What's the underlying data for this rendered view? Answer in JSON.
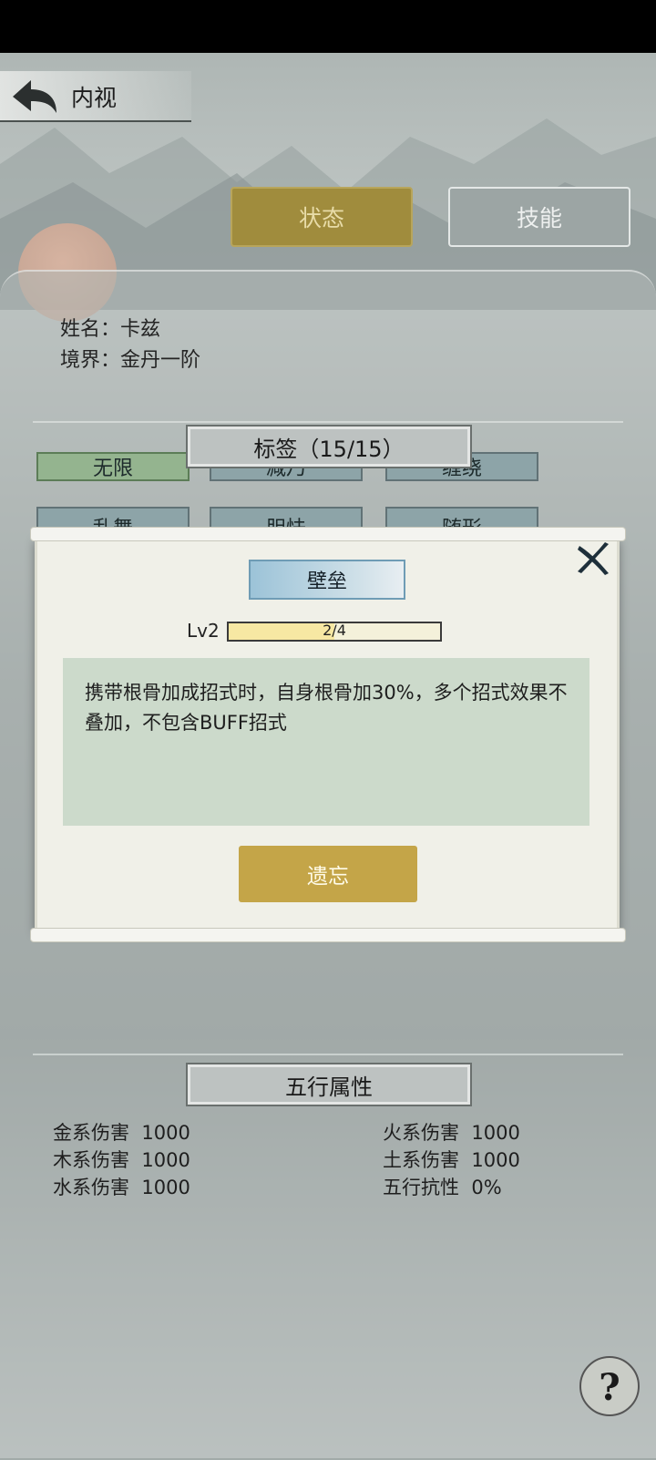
{
  "header": {
    "title": "内视"
  },
  "tabs": [
    {
      "label": "状态",
      "active": true
    },
    {
      "label": "技能",
      "active": false
    }
  ],
  "character": {
    "name_label": "姓名：卡兹",
    "realm_label": "境界：金丹一阶"
  },
  "tags_section": {
    "title": "标签（15/15）",
    "tags": [
      "无限",
      "减乃",
      "缠绕",
      "乱舞",
      "胆怯",
      "随形"
    ]
  },
  "modal": {
    "skill_name": "壁垒",
    "level_label": "Lv2",
    "progress_text": "2/4",
    "progress_fraction": 0.5,
    "description": "携带根骨加成招式时，自身根骨加30%，多个招式效果不叠加，不包含BUFF招式",
    "forget_button": "遗忘"
  },
  "elements_section": {
    "title": "五行属性",
    "stats": [
      {
        "label": "金系伤害",
        "value": "1000"
      },
      {
        "label": "火系伤害",
        "value": "1000"
      },
      {
        "label": "木系伤害",
        "value": "1000"
      },
      {
        "label": "土系伤害",
        "value": "1000"
      },
      {
        "label": "水系伤害",
        "value": "1000"
      },
      {
        "label": "五行抗性",
        "value": "0%"
      }
    ]
  },
  "colors": {
    "gold": "#c4a548",
    "teal_tag": "#8da4a8",
    "green_tag": "#94b48f",
    "desc_bg": "#ccdacb"
  }
}
